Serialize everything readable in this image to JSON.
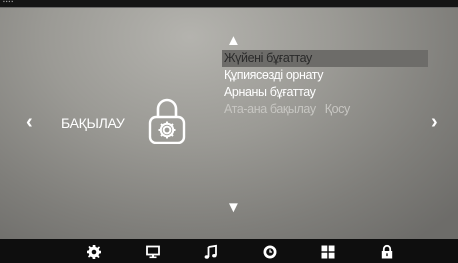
{
  "screen": {
    "section_title": "БАҚЫЛАУ",
    "section_icon": "padlock-gear-icon",
    "nav": {
      "left": "‹",
      "right": "›"
    },
    "scroll": {
      "up": "▲",
      "down": "▼"
    },
    "menu_items": [
      {
        "label": "Жүйені бұғаттау",
        "state": "selected"
      },
      {
        "label": "Құпиясөзді орнату",
        "state": "normal"
      },
      {
        "label": "Арнаны бұғаттау",
        "state": "normal"
      },
      {
        "label": "Ата-ана бақылау",
        "value": "Қосу",
        "state": "disabled"
      }
    ]
  },
  "bottom_tabs": [
    {
      "icon": "gear-icon"
    },
    {
      "icon": "monitor-icon"
    },
    {
      "icon": "music-note-icon"
    },
    {
      "icon": "clock-icon"
    },
    {
      "icon": "grid-icon"
    },
    {
      "icon": "lock-icon",
      "active": true
    }
  ],
  "colors": {
    "panel_light": "#b4b3ae",
    "panel_dark": "#6d6c69",
    "selection_bg": "#6d6c69",
    "disabled_text": "#c7c6c2",
    "bar": "#0e0e0e"
  }
}
